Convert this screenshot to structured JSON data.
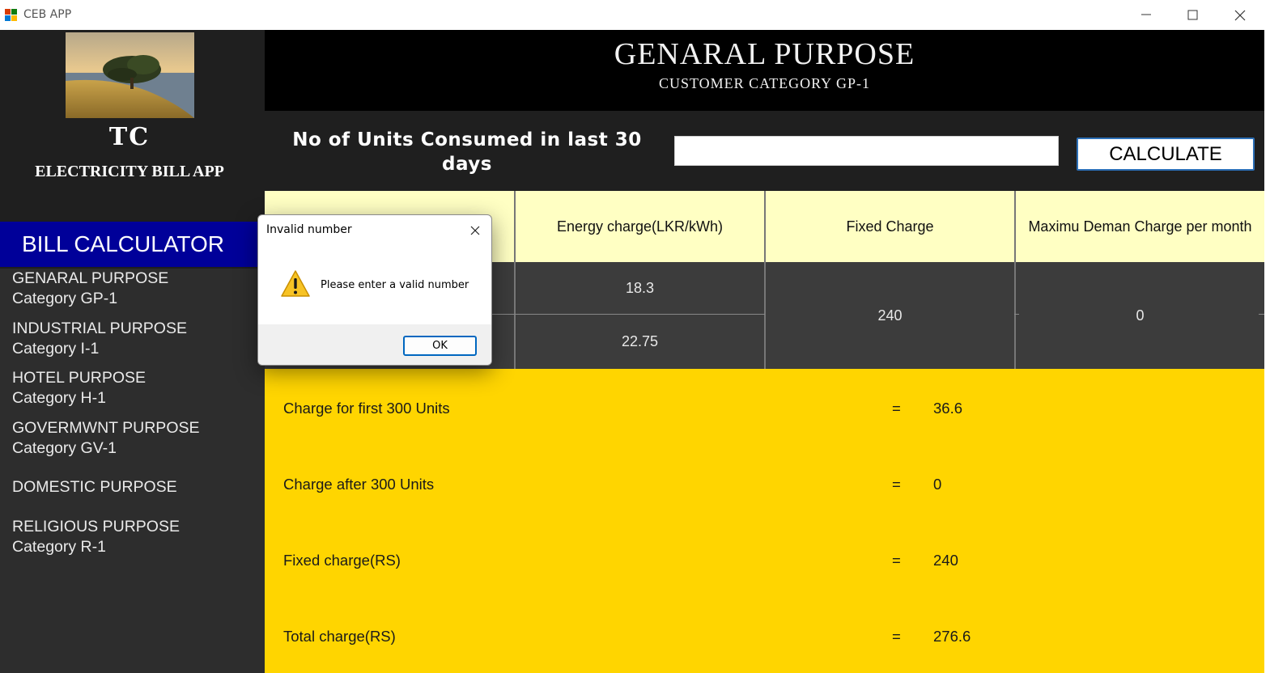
{
  "window": {
    "title": "CEB APP",
    "icons": [
      "app-icon",
      "minimize-icon",
      "maximize-icon",
      "close-icon"
    ]
  },
  "sidebar": {
    "brand_short": "TC",
    "brand_name": "ELECTRICITY BILL APP",
    "section_title": "BILL CALCULATOR",
    "items": [
      {
        "line1": "GENARAL PURPOSE",
        "line2": "Category GP-1"
      },
      {
        "line1": "INDUSTRIAL PURPOSE",
        "line2": "Category I-1"
      },
      {
        "line1": "HOTEL PURPOSE",
        "line2": "Category H-1"
      },
      {
        "line1": "GOVERMWNT PURPOSE",
        "line2": "Category GV-1"
      },
      {
        "line1": "DOMESTIC PURPOSE",
        "line2": ""
      },
      {
        "line1": "RELIGIOUS PURPOSE",
        "line2": "Category R-1"
      }
    ]
  },
  "header": {
    "title": "GENARAL PURPOSE",
    "subtitle": "CUSTOMER CATEGORY GP-1"
  },
  "input": {
    "label_line1": "No of Units Consumed in last 30",
    "label_line2": "days",
    "value": "",
    "button_label": "CALCULATE"
  },
  "table": {
    "headers": [
      "",
      "Energy charge(LKR/kWh)",
      "Fixed Charge",
      "Maximu Deman Charge per month"
    ],
    "energy_charges": [
      "18.3",
      "22.75"
    ],
    "fixed_charge": "240",
    "max_demand_charge": "0"
  },
  "results": [
    {
      "label": "Charge for first 300 Units",
      "eq": "=",
      "value": "36.6"
    },
    {
      "label": "Charge after 300 Units",
      "eq": "=",
      "value": "0"
    },
    {
      "label": "Fixed charge(RS)",
      "eq": "=",
      "value": "240"
    },
    {
      "label": "Total charge(RS)",
      "eq": "=",
      "value": "276.6"
    }
  ],
  "dialog": {
    "title": "Invalid number",
    "message": "Please enter a valid number",
    "ok_label": "OK",
    "icon": "warning-icon"
  },
  "colors": {
    "sidebar_bg": "#1f1f1f",
    "nav_bg": "#2d2d2d",
    "section_head_bg": "#000099",
    "header_bg": "#000000",
    "table_header_bg": "#ffffc3",
    "table_body_bg": "#3c3c3c",
    "results_bg": "#ffd500",
    "accent_blue": "#0067c0"
  }
}
